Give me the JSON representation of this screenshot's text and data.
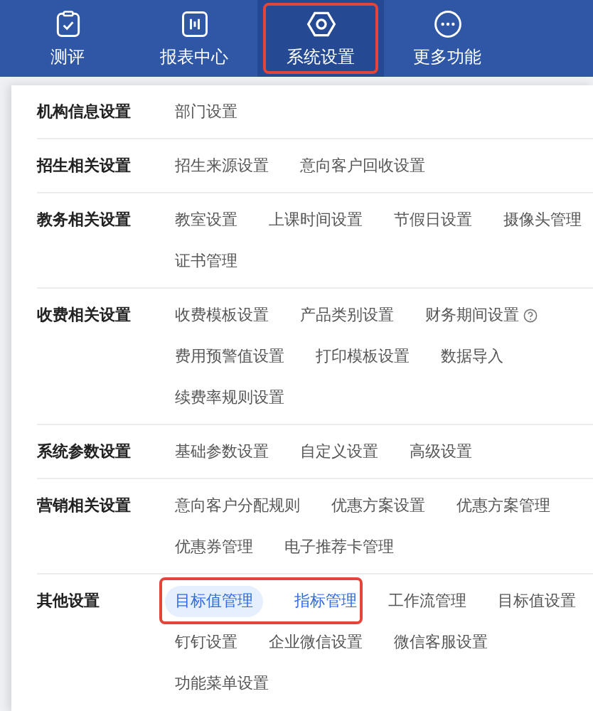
{
  "nav": {
    "tabs": [
      {
        "label": "测评",
        "selected": false,
        "annotated": false
      },
      {
        "label": "报表中心",
        "selected": false,
        "annotated": false
      },
      {
        "label": "系统设置",
        "selected": true,
        "annotated": true
      },
      {
        "label": "更多功能",
        "selected": false,
        "annotated": false
      }
    ]
  },
  "sections": [
    {
      "title": "机构信息设置",
      "items": [
        {
          "kind": "link",
          "label": "部门设置",
          "selected": false,
          "active": false
        }
      ]
    },
    {
      "title": "招生相关设置",
      "items": [
        {
          "kind": "link",
          "label": "招生来源设置",
          "selected": false,
          "active": false
        },
        {
          "kind": "link",
          "label": "意向客户回收设置",
          "selected": false,
          "active": false
        }
      ]
    },
    {
      "title": "教务相关设置",
      "items": [
        {
          "kind": "link",
          "label": "教室设置",
          "selected": false,
          "active": false
        },
        {
          "kind": "link",
          "label": "上课时间设置",
          "selected": false,
          "active": false
        },
        {
          "kind": "link",
          "label": "节假日设置",
          "selected": false,
          "active": false
        },
        {
          "kind": "link",
          "label": "摄像头管理",
          "selected": false,
          "active": false
        },
        {
          "kind": "link",
          "label": "证书管理",
          "selected": false,
          "active": false
        }
      ]
    },
    {
      "title": "收费相关设置",
      "items": [
        {
          "kind": "link",
          "label": "收费模板设置",
          "selected": false,
          "active": false
        },
        {
          "kind": "link",
          "label": "产品类别设置",
          "selected": false,
          "active": false
        },
        {
          "kind": "link",
          "label": "财务期间设置",
          "selected": false,
          "active": false,
          "help": true
        },
        {
          "kind": "link",
          "label": "费用预警值设置",
          "selected": false,
          "active": false
        },
        {
          "kind": "link",
          "label": "打印模板设置",
          "selected": false,
          "active": false
        },
        {
          "kind": "link",
          "label": "数据导入",
          "selected": false,
          "active": false
        },
        {
          "kind": "link",
          "label": "续费率规则设置",
          "selected": false,
          "active": false
        }
      ]
    },
    {
      "title": "系统参数设置",
      "items": [
        {
          "kind": "link",
          "label": "基础参数设置",
          "selected": false,
          "active": false
        },
        {
          "kind": "link",
          "label": "自定义设置",
          "selected": false,
          "active": false
        },
        {
          "kind": "link",
          "label": "高级设置",
          "selected": false,
          "active": false
        }
      ]
    },
    {
      "title": "营销相关设置",
      "items": [
        {
          "kind": "link",
          "label": "意向客户分配规则",
          "selected": false,
          "active": false
        },
        {
          "kind": "link",
          "label": "优惠方案设置",
          "selected": false,
          "active": false
        },
        {
          "kind": "link",
          "label": "优惠方案管理",
          "selected": false,
          "active": false
        },
        {
          "kind": "link",
          "label": "优惠券管理",
          "selected": false,
          "active": false
        },
        {
          "kind": "link",
          "label": "电子推荐卡管理",
          "selected": false,
          "active": false
        }
      ]
    },
    {
      "title": "其他设置",
      "items": [
        {
          "kind": "group",
          "annotated": true,
          "items": [
            {
              "kind": "link",
              "label": "目标值管理",
              "selected": true,
              "active": true
            },
            {
              "kind": "link",
              "label": "指标管理",
              "selected": false,
              "active": true
            }
          ]
        },
        {
          "kind": "link",
          "label": "工作流管理",
          "selected": false,
          "active": false
        },
        {
          "kind": "link",
          "label": "目标值设置",
          "selected": false,
          "active": false
        },
        {
          "kind": "link",
          "label": "钉钉设置",
          "selected": false,
          "active": false
        },
        {
          "kind": "link",
          "label": "企业微信设置",
          "selected": false,
          "active": false
        },
        {
          "kind": "link",
          "label": "微信客服设置",
          "selected": false,
          "active": false
        },
        {
          "kind": "link",
          "label": "功能菜单设置",
          "selected": false,
          "active": false
        }
      ]
    }
  ]
}
